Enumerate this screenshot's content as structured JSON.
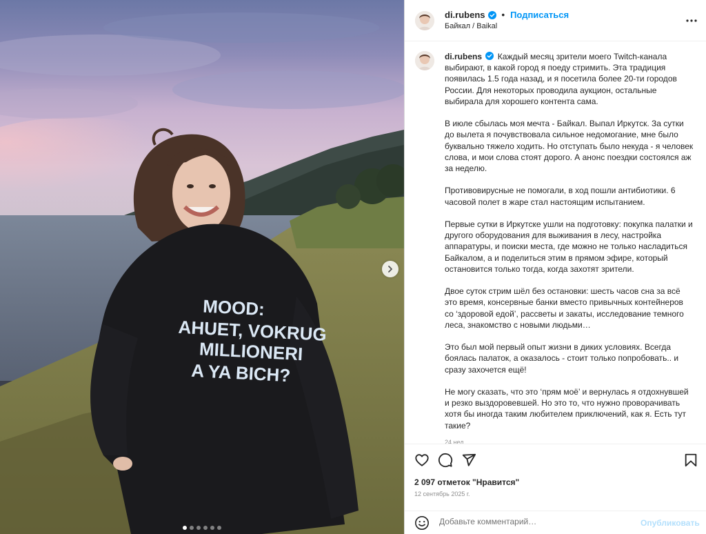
{
  "header": {
    "username": "di.rubens",
    "separator": "•",
    "follow_label": "Подписаться",
    "location": "Байкал / Baikal",
    "more_icon": "more-horizontal-icon"
  },
  "media": {
    "shirt_text": [
      "MOOD:",
      "AHUET, VOKRUG",
      "MILLIONERI",
      "A YA BICH?"
    ],
    "next_icon": "chevron-right-icon",
    "carousel_dot_count": 6,
    "carousel_active_index": 0
  },
  "caption": {
    "username": "di.rubens",
    "paragraphs": [
      "Каждый месяц зрители моего Twitch-канала выбирают, в какой город я поеду стримить. Эта традиция появилась 1.5 года назад, и я посетила более 20-ти городов России. Для некоторых проводила аукцион, остальные выбирала для хорошего контента сама.",
      "В июле сбылась моя мечта - Байкал. Выпал Иркутск. За сутки до вылета я почувствовала сильное недомогание, мне было буквально тяжело ходить. Но отступать было некуда - я человек слова, и мои слова стоят дорого. А анонс поездки состоялся аж за неделю.",
      "Противовирусные не помогали, в ход пошли антибиотики. 6 часовой полет в жаре стал настоящим испытанием.",
      "Первые сутки в Иркутске ушли на подготовку: покупка палатки и другого оборудования для выживания в лесу, настройка аппаратуры, и поиски места, где можно не только насладиться Байкалом, а и поделиться этим в прямом эфире, который остановится только тогда, когда захотят зрители.",
      "Двое суток стрим шёл без остановки: шесть часов сна за всё это время, консервные банки вместо привычных контейнеров со ‘здоровой едой’, рассветы и закаты, исследование темного леса, знакомство с новыми людьми…",
      "Это был мой первый опыт жизни в диких условиях. Всегда боялась палаток, а оказалось - стоит только попробовать.. и сразу захочется ещё!",
      "Не могу сказать, что это ‘прям моё’ и вернулась я отдохнувшей и резко выздоровевшей. Но это то, что нужно проворачивать хотя бы иногда таким любителем приключений, как я. Есть тут такие?"
    ],
    "time": "24 нед."
  },
  "actions": {
    "icons": [
      "heart-icon",
      "comment-icon",
      "share-icon",
      "bookmark-icon"
    ]
  },
  "likes": "2 097 отметок \"Нравится\"",
  "date": "12 сентябрь 2025 г.",
  "comment": {
    "placeholder": "Добавьте комментарий…",
    "publish_label": "Опубликовать"
  },
  "colors": {
    "accent": "#0095f6",
    "verified": "#0095f6",
    "publish_disabled": "#b2dffc",
    "muted": "#8e8e8e"
  }
}
